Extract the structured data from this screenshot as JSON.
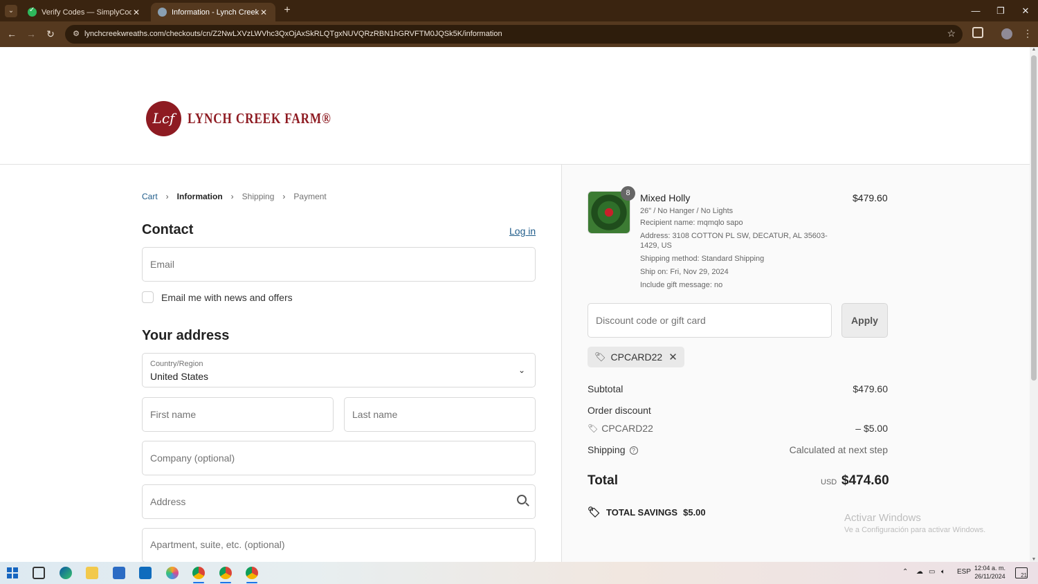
{
  "browser": {
    "tabs": [
      {
        "label": "Verify Codes — SimplyCodes"
      },
      {
        "label": "Information - Lynch Creek Farm"
      }
    ],
    "url": "lynchcreekwreaths.com/checkouts/cn/Z2NwLXVzLWVhc3QxOjAxSkRLQTgxNUVQRzRBN1hGRVFTM0JQSk5K/information"
  },
  "header": {
    "logo_mark": "Lcf",
    "logo_text": "LYNCH CREEK FARM®"
  },
  "breadcrumb": {
    "cart": "Cart",
    "information": "Information",
    "shipping": "Shipping",
    "payment": "Payment"
  },
  "contact": {
    "heading": "Contact",
    "login_link": "Log in",
    "email_placeholder": "Email",
    "newsletter_label": "Email me with news and offers"
  },
  "address": {
    "heading": "Your address",
    "country_label": "Country/Region",
    "country_value": "United States",
    "first_name_placeholder": "First name",
    "last_name_placeholder": "Last name",
    "company_placeholder": "Company (optional)",
    "address_placeholder": "Address",
    "apartment_placeholder": "Apartment, suite, etc. (optional)"
  },
  "order": {
    "quantity": "8",
    "product_name": "Mixed Holly",
    "variant": "26\" / No Hanger / No Lights",
    "recipient": "Recipient name: mqmqlo sapo",
    "address": "Address: 3108 COTTON PL SW, DECATUR, AL 35603-1429, US",
    "shipping_method": "Shipping method: Standard Shipping",
    "ship_on": "Ship on: Fri, Nov 29, 2024",
    "gift_message": "Include gift message: no",
    "price": "$479.60"
  },
  "discount": {
    "placeholder": "Discount code or gift card",
    "apply_label": "Apply",
    "applied_code": "CPCARD22"
  },
  "summary": {
    "subtotal_label": "Subtotal",
    "subtotal_value": "$479.60",
    "order_discount_label": "Order discount",
    "discount_code": "CPCARD22",
    "discount_value": "– $5.00",
    "shipping_label": "Shipping",
    "shipping_value": "Calculated at next step",
    "total_label": "Total",
    "currency": "USD",
    "total_value": "$474.60",
    "savings_label": "TOTAL SAVINGS",
    "savings_value": "$5.00"
  },
  "watermark": {
    "line1": "Activar Windows",
    "line2": "Ve a Configuración para activar Windows."
  },
  "taskbar": {
    "language": "ESP",
    "time": "12:04 a. m.",
    "date": "26/11/2024",
    "notifications": "21"
  }
}
